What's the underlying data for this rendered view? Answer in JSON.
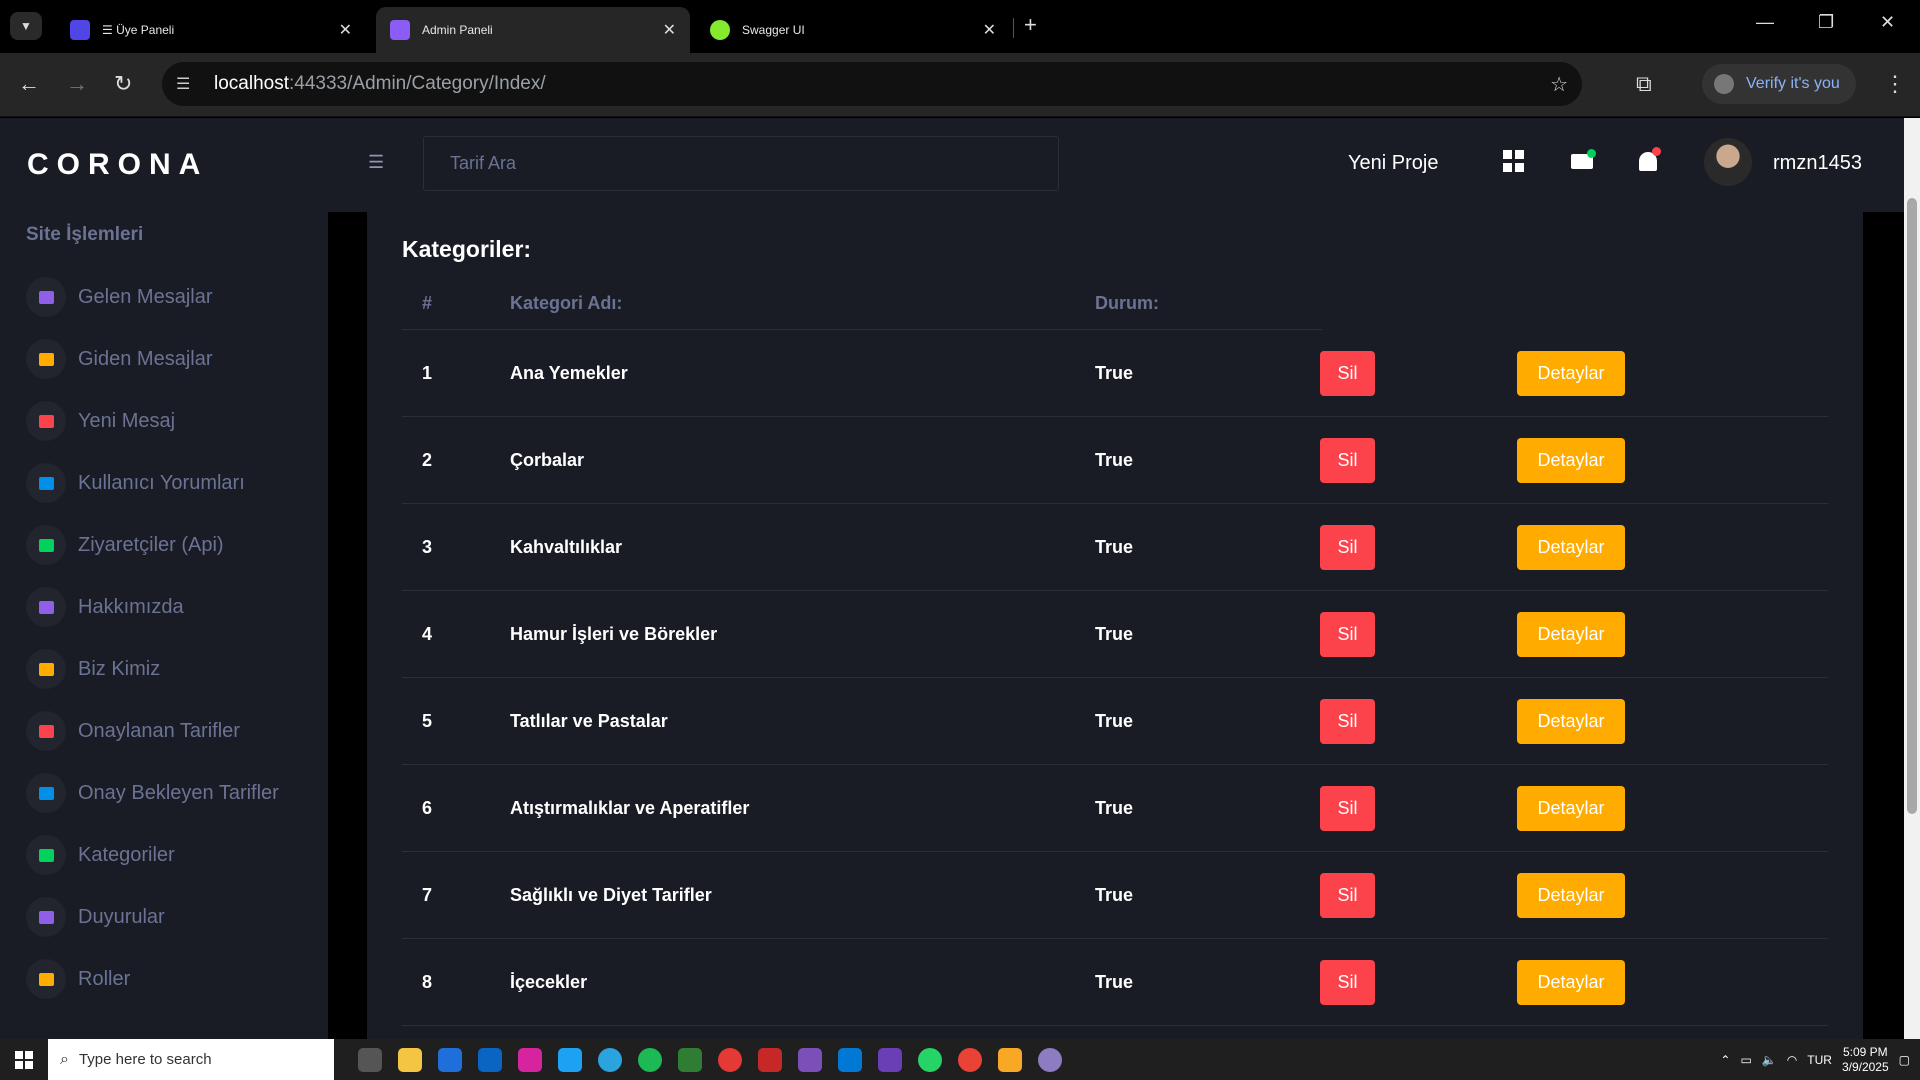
{
  "browser": {
    "tabs": [
      {
        "title": "☰ Üye Paneli",
        "favicon_color": "#4f46e5"
      },
      {
        "title": "Admin Paneli",
        "favicon_color": "#8b5cf6"
      },
      {
        "title": "Swagger UI",
        "favicon_color": "#85ea2d"
      }
    ],
    "url_host": "localhost",
    "url_rest": ":44333/Admin/Category/Index/",
    "verify_label": "Verify it's you"
  },
  "app": {
    "brand": "CORONA",
    "sidebar_title": "Site İşlemleri",
    "menu": [
      {
        "label": "Gelen Mesajlar",
        "color": "#8f5fe8"
      },
      {
        "label": "Giden Mesajlar",
        "color": "#ffab00"
      },
      {
        "label": "Yeni Mesaj",
        "color": "#fc424a"
      },
      {
        "label": "Kullanıcı Yorumları",
        "color": "#0090e7"
      },
      {
        "label": "Ziyaretçiler (Api)",
        "color": "#00d25b"
      },
      {
        "label": "Hakkımızda",
        "color": "#8f5fe8"
      },
      {
        "label": "Biz Kimiz",
        "color": "#ffab00"
      },
      {
        "label": "Onaylanan Tarifler",
        "color": "#fc424a"
      },
      {
        "label": "Onay Bekleyen Tarifler",
        "color": "#0090e7"
      },
      {
        "label": "Kategoriler",
        "color": "#00d25b"
      },
      {
        "label": "Duyurular",
        "color": "#8f5fe8"
      },
      {
        "label": "Roller",
        "color": "#ffab00"
      }
    ],
    "search_placeholder": "Tarif Ara",
    "new_project": "Yeni Proje",
    "username": "rmzn1453",
    "mail_dot_color": "#00d25b",
    "bell_dot_color": "#fc424a"
  },
  "card": {
    "title": "Kategoriler:",
    "headers": {
      "num": "#",
      "name": "Kategori Adı:",
      "status": "Durum:"
    },
    "delete_label": "Sil",
    "details_label": "Detaylar",
    "rows": [
      {
        "num": "1",
        "name": "Ana Yemekler",
        "status": "True"
      },
      {
        "num": "2",
        "name": "Çorbalar",
        "status": "True"
      },
      {
        "num": "3",
        "name": "Kahvaltılıklar",
        "status": "True"
      },
      {
        "num": "4",
        "name": "Hamur İşleri ve Börekler",
        "status": "True"
      },
      {
        "num": "5",
        "name": "Tatlılar ve Pastalar",
        "status": "True"
      },
      {
        "num": "6",
        "name": "Atıştırmalıklar ve Aperatifler",
        "status": "True"
      },
      {
        "num": "7",
        "name": "Sağlıklı ve Diyet Tarifler",
        "status": "True"
      },
      {
        "num": "8",
        "name": "İçecekler",
        "status": "True"
      }
    ]
  },
  "taskbar": {
    "search_placeholder": "Type here to search",
    "lang": "TUR",
    "time": "5:09 PM",
    "date": "3/9/2025"
  }
}
